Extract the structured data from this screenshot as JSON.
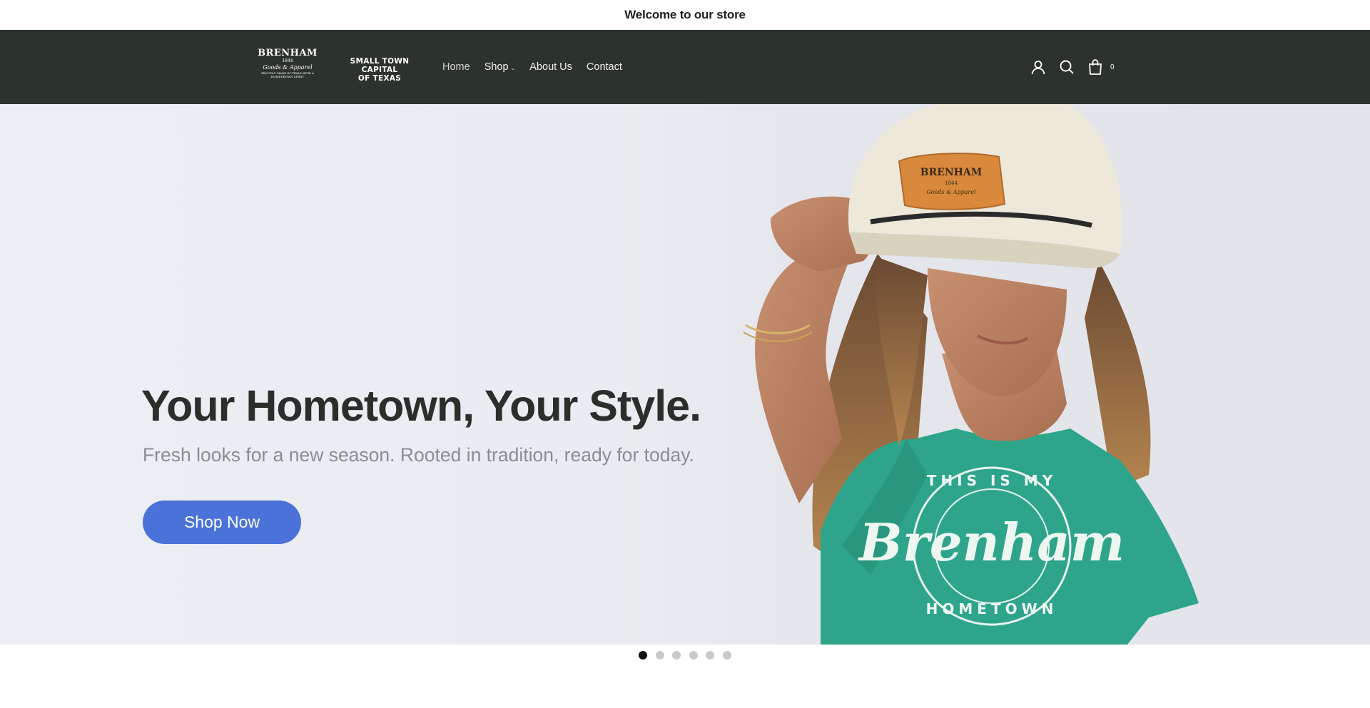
{
  "announcement": {
    "text": "Welcome to our store"
  },
  "header": {
    "logo_main": {
      "title": "BRENHAM",
      "year": "1844",
      "script": "Goods & Apparel",
      "tagline": "PROUDLY MADE IN TEXAS WITH A HOMEGROWN SPIRIT"
    },
    "logo_secondary": {
      "line1": "SMALL TOWN CAPITAL",
      "line2": "OF TEXAS"
    },
    "nav": [
      {
        "label": "Home"
      },
      {
        "label": "Shop"
      },
      {
        "label": "About Us"
      },
      {
        "label": "Contact"
      }
    ],
    "icons": [
      "user-icon",
      "search-icon",
      "cart-icon"
    ],
    "cart_count": "0"
  },
  "hero": {
    "title": "Your Hometown, Your Style.",
    "subtitle": "Fresh looks for a new season. Rooted in tradition, ready for today.",
    "button_label": "Shop Now",
    "shirt_text": {
      "top": "THIS IS MY",
      "script": "Brenham",
      "bottom": "HOMETOWN"
    },
    "cap_patch": {
      "title": "BRENHAM",
      "year": "1844",
      "script": "Goods & Apparel"
    }
  },
  "slider": {
    "total": 6,
    "active": 1
  },
  "colors": {
    "header_bg": "#2c332d",
    "accent": "#4a72d9",
    "shirt": "#2ea58a",
    "title": "#2b2f2c"
  }
}
